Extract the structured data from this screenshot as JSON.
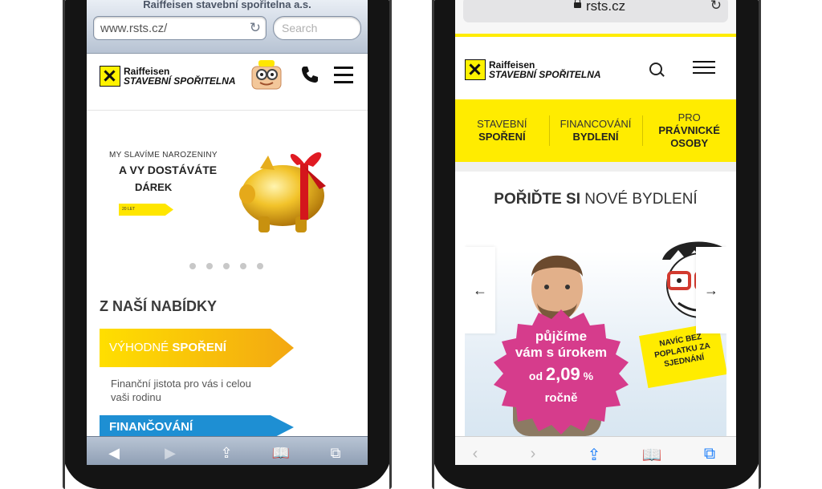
{
  "left_phone": {
    "browser": {
      "page_title": "Raiffeisen stavební spořitelna a.s.",
      "url": "www.rsts.cz/",
      "search_placeholder": "Search"
    },
    "logo": {
      "top": "Raiffeisen",
      "bottom": "STAVEBNÍ SPOŘITELNA"
    },
    "banner": {
      "line1": "MY SLAVÍME NAROZENINY",
      "line2": "A VY DOSTÁVÁTE",
      "line3": "DÁREK",
      "tag": "20 LET"
    },
    "slider_dots": 5,
    "section_title": "Z NAŠÍ NABÍDKY",
    "offer1": {
      "light": "VÝHODNÉ ",
      "bold": "SPOŘENÍ"
    },
    "offer1_text": "Finanční jistota pro vás i celou vaši rodinu",
    "offer2": "FINANČOVÁNÍ",
    "colors": {
      "yellow": "#ffdf00",
      "orange": "#f3a712",
      "blue": "#1e8fd3"
    }
  },
  "right_phone": {
    "browser": {
      "url": "rsts.cz"
    },
    "logo": {
      "top": "Raiffeisen",
      "bottom": "STAVEBNÍ SPOŘITELNA"
    },
    "nav": [
      {
        "light": "STAVEBNÍ",
        "bold": "SPOŘENÍ"
      },
      {
        "light": "FINANCOVÁNÍ",
        "bold": "BYDLENÍ"
      },
      {
        "light": "PRO",
        "bold": "PRÁVNICKÉ OSOBY"
      }
    ],
    "hero": {
      "title_bold": "POŘIĎTE SI",
      "title_light": " NOVÉ BYDLENÍ",
      "badge_line1": "půjčíme",
      "badge_line2": "vám s úrokem",
      "badge_prefix": "od ",
      "badge_rate": "2,09",
      "badge_suffix": " %",
      "badge_line4": "ročně",
      "note": "NAVÍC BEZ POPLATKU ZA SJEDNÁNÍ"
    },
    "colors": {
      "yellow": "#ffec00",
      "magenta": "#d63c8c",
      "ios_blue": "#1a7dfa"
    }
  }
}
